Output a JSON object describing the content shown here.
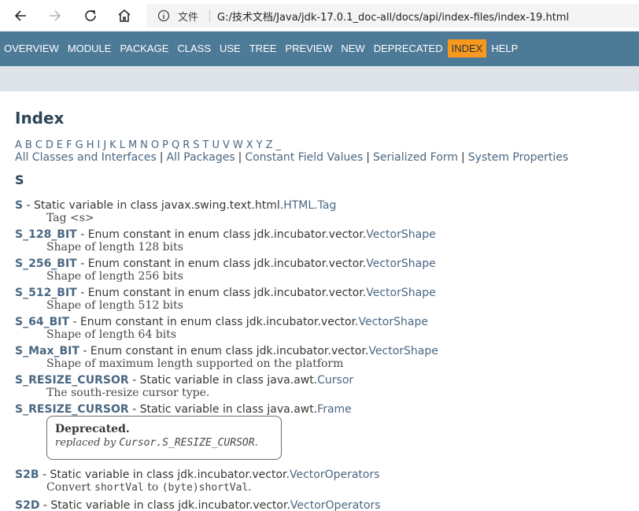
{
  "browser": {
    "file_label": "文件",
    "url": "G:/技术文档/Java/jdk-17.0.1_doc-all/docs/api/index-files/index-19.html"
  },
  "nav": {
    "items": [
      {
        "label": "OVERVIEW"
      },
      {
        "label": "MODULE"
      },
      {
        "label": "PACKAGE"
      },
      {
        "label": "CLASS"
      },
      {
        "label": "USE"
      },
      {
        "label": "TREE"
      },
      {
        "label": "PREVIEW"
      },
      {
        "label": "NEW"
      },
      {
        "label": "DEPRECATED"
      },
      {
        "label": "INDEX",
        "active": true
      },
      {
        "label": "HELP"
      }
    ]
  },
  "page": {
    "title": "Index",
    "letters": [
      "A",
      "B",
      "C",
      "D",
      "E",
      "F",
      "G",
      "H",
      "I",
      "J",
      "K",
      "L",
      "M",
      "N",
      "O",
      "P",
      "Q",
      "R",
      "S",
      "T",
      "U",
      "V",
      "W",
      "X",
      "Y",
      "Z",
      "_"
    ],
    "all_links": [
      "All Classes and Interfaces",
      "All Packages",
      "Constant Field Values",
      "Serialized Form",
      "System Properties"
    ],
    "section_letter": "S"
  },
  "entries": [
    {
      "name": "S",
      "kind": " - Static variable in class javax.swing.text.html.",
      "link": "HTML.Tag",
      "desc": "Tag <s>"
    },
    {
      "name": "S_128_BIT",
      "kind": " - Enum constant in enum class jdk.incubator.vector.",
      "link": "VectorShape",
      "desc": "Shape of length 128 bits"
    },
    {
      "name": "S_256_BIT",
      "kind": " - Enum constant in enum class jdk.incubator.vector.",
      "link": "VectorShape",
      "desc": "Shape of length 256 bits"
    },
    {
      "name": "S_512_BIT",
      "kind": " - Enum constant in enum class jdk.incubator.vector.",
      "link": "VectorShape",
      "desc": "Shape of length 512 bits"
    },
    {
      "name": "S_64_BIT",
      "kind": " - Enum constant in enum class jdk.incubator.vector.",
      "link": "VectorShape",
      "desc": "Shape of length 64 bits"
    },
    {
      "name": "S_Max_BIT",
      "kind": " - Enum constant in enum class jdk.incubator.vector.",
      "link": "VectorShape",
      "desc": "Shape of maximum length supported on the platform"
    },
    {
      "name": "S_RESIZE_CURSOR",
      "kind": " - Static variable in class java.awt.",
      "link": "Cursor",
      "desc": "The south-resize cursor type."
    },
    {
      "name": "S_RESIZE_CURSOR",
      "kind": " - Static variable in class java.awt.",
      "link": "Frame",
      "desc": ""
    },
    {
      "name": "S2B",
      "kind": " - Static variable in class jdk.incubator.vector.",
      "link": "VectorOperators",
      "desc_prefix": "Convert ",
      "desc_code1": "shortVal",
      "desc_mid": " to ",
      "desc_code2": "(byte)shortVal",
      "desc_suffix": "."
    },
    {
      "name": "S2D",
      "kind": " - Static variable in class jdk.incubator.vector.",
      "link": "VectorOperators",
      "desc": ""
    }
  ],
  "deprecated": {
    "title": "Deprecated.",
    "text_prefix": "replaced by ",
    "code": "Cursor.S_RESIZE_CURSOR",
    "text_suffix": "."
  }
}
